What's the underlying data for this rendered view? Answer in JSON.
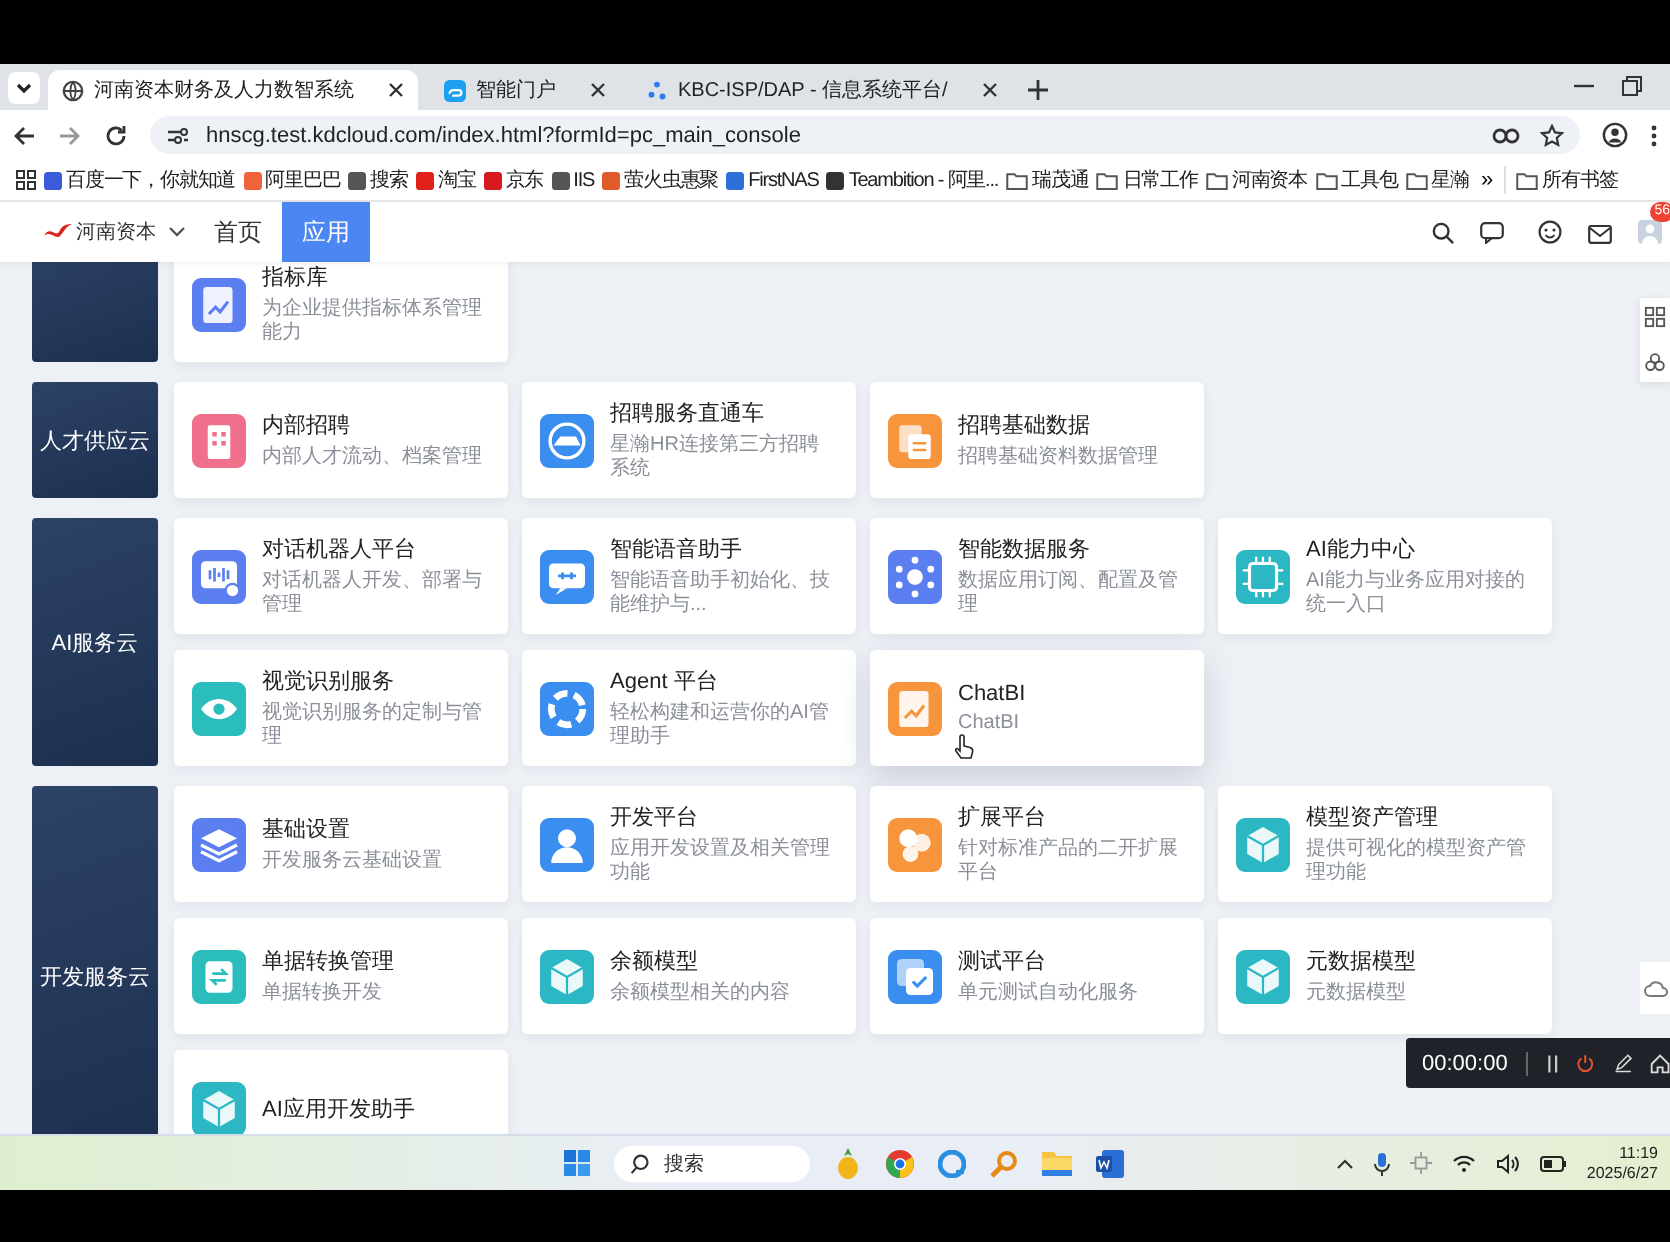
{
  "browser": {
    "tabs": [
      {
        "title": "河南资本财务及人力数智系统",
        "selected": true,
        "kind": "globe"
      },
      {
        "title": "智能门户",
        "selected": false,
        "kind": "app"
      },
      {
        "title": "KBC-ISP/DAP - 信息系统平台/",
        "selected": false,
        "kind": "dots"
      }
    ],
    "address": "hnscg.test.kdcloud.com/index.html?formId=pc_main_console",
    "bookmarks": [
      {
        "label": "百度一下，你就知道",
        "kind": "site",
        "color": "#3b5bdb"
      },
      {
        "label": "阿里巴巴",
        "kind": "site",
        "color": "#f0643c"
      },
      {
        "label": "搜索",
        "kind": "site",
        "color": "#555555"
      },
      {
        "label": "淘宝",
        "kind": "site",
        "color": "#e0201a"
      },
      {
        "label": "京东",
        "kind": "site",
        "color": "#d71920"
      },
      {
        "label": "IIS",
        "kind": "site",
        "color": "#555555"
      },
      {
        "label": "萤火虫惠聚",
        "kind": "site",
        "color": "#e05a2a"
      },
      {
        "label": "FirstNAS",
        "kind": "site",
        "color": "#2e6fd8"
      },
      {
        "label": "Teambition - 阿里...",
        "kind": "site",
        "color": "#333333"
      },
      {
        "label": "瑞茂通",
        "kind": "folder",
        "color": "#555555"
      },
      {
        "label": "日常工作",
        "kind": "folder",
        "color": "#555555"
      },
      {
        "label": "河南资本",
        "kind": "folder",
        "color": "#555555"
      },
      {
        "label": "工具包",
        "kind": "folder",
        "color": "#555555"
      },
      {
        "label": "星瀚",
        "kind": "folder",
        "color": "#555555"
      }
    ],
    "more": "»",
    "all_bookmarks": "所有书签"
  },
  "app_header": {
    "logo_text": "河南资本",
    "nav": [
      {
        "label": "首页",
        "selected": false
      },
      {
        "label": "应用",
        "selected": true
      }
    ],
    "badge": "56"
  },
  "sections": [
    {
      "cards": [
        {
          "title": "指标库",
          "description": "为企业提供指标体系管理能力",
          "kind": "chart",
          "color": "#5b7ff0",
          "hovered": false
        }
      ]
    },
    {
      "label": "人才供应云",
      "cards": [
        {
          "title": "内部招聘",
          "description": "内部人才流动、档案管理",
          "kind": "building",
          "color": "#f0708c",
          "hovered": false
        },
        {
          "title": "招聘服务直通车",
          "description": "星瀚HR连接第三方招聘系统",
          "kind": "car",
          "color": "#3a8ef0",
          "hovered": false
        },
        {
          "title": "招聘基础数据",
          "description": "招聘基础资料数据管理",
          "kind": "files",
          "color": "#f7953d",
          "hovered": false
        }
      ]
    },
    {
      "label": "AI服务云",
      "cards": [
        {
          "title": "对话机器人平台",
          "description": "对话机器人开发、部署与管理",
          "kind": "voice",
          "color": "#5b7ff0",
          "hovered": false
        },
        {
          "title": "智能语音助手",
          "description": "智能语音助手初始化、技能维护与...",
          "kind": "speech",
          "color": "#3a8ef0",
          "hovered": false
        },
        {
          "title": "智能数据服务",
          "description": "数据应用订阅、配置及管理",
          "kind": "network",
          "color": "#5b7ff0",
          "hovered": false
        },
        {
          "title": "AI能力中心",
          "description": "AI能力与业务应用对接的统一入口",
          "kind": "chip",
          "color": "#2bb8c4",
          "hovered": false
        },
        {
          "title": "视觉识别服务",
          "description": "视觉识别服务的定制与管理",
          "kind": "eye",
          "color": "#2bbcbc",
          "hovered": false
        },
        {
          "title": "Agent 平台",
          "description": "轻松构建和运营你的AI管理助手",
          "kind": "swirl",
          "color": "#3a8ef0",
          "hovered": false
        },
        {
          "title": "ChatBI",
          "description": "ChatBI",
          "kind": "chart",
          "color": "#f7953d",
          "hovered": true
        }
      ]
    },
    {
      "label": "开发服务云",
      "cards": [
        {
          "title": "基础设置",
          "description": "开发服务云基础设置",
          "kind": "layers",
          "color": "#5b7ff0",
          "hovered": false
        },
        {
          "title": "开发平台",
          "description": "应用开发设置及相关管理功能",
          "kind": "person",
          "color": "#3a8ef0",
          "hovered": false
        },
        {
          "title": "扩展平台",
          "description": "针对标准产品的二开扩展平台",
          "kind": "circles",
          "color": "#f7953d",
          "hovered": false
        },
        {
          "title": "模型资产管理",
          "description": "提供可视化的模型资产管理功能",
          "kind": "cube",
          "color": "#2bb8c4",
          "hovered": false
        },
        {
          "title": "单据转换管理",
          "description": "单据转换开发",
          "kind": "swap",
          "color": "#2bbcbc",
          "hovered": false
        },
        {
          "title": "余额模型",
          "description": "余额模型相关的内容",
          "kind": "cube",
          "color": "#2bb8c4",
          "hovered": false
        },
        {
          "title": "测试平台",
          "description": "单元测试自动化服务",
          "kind": "check",
          "color": "#3a8ef0",
          "hovered": false
        },
        {
          "title": "元数据模型",
          "description": "元数据模型",
          "kind": "cube",
          "color": "#2bb8c4",
          "hovered": false
        },
        {
          "title": "AI应用开发助手",
          "kind": "cube",
          "color": "#2bb8c4",
          "hovered": false
        }
      ]
    }
  ],
  "recorder": {
    "time": "00:00:00"
  },
  "taskbar": {
    "search": "搜索",
    "time": "11:19",
    "date": "2025/6/27"
  }
}
